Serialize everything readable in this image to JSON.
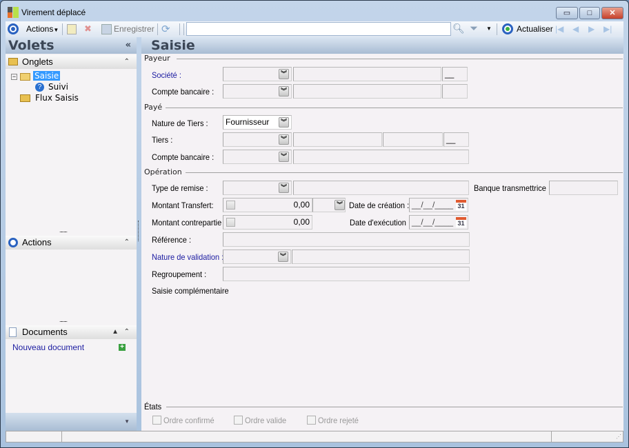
{
  "window": {
    "title": "Virement déplacé",
    "minimize": "▭",
    "maximize": "□",
    "close": "✕"
  },
  "toolbar": {
    "actions": "Actions",
    "save": "Enregistrer",
    "search_value": "",
    "refresh": "Actualiser"
  },
  "left": {
    "title": "Volets",
    "collapse": "«",
    "onglets": {
      "label": "Onglets",
      "tree": [
        {
          "label": "Saisie",
          "selected": true
        },
        {
          "label": "Suivi"
        },
        {
          "label": "Flux Saisis"
        }
      ]
    },
    "actions": {
      "label": "Actions"
    },
    "documents": {
      "label": "Documents",
      "new_doc": "Nouveau document"
    }
  },
  "main": {
    "title": "Saisie",
    "payeur": {
      "legend": "Payeur",
      "societe": "Société :",
      "compte": "Compte bancaire :",
      "societe_code": "__"
    },
    "paye": {
      "legend": "Payé",
      "nature": "Nature de Tiers :",
      "nature_value": "Fournisseur",
      "tiers": "Tiers :",
      "tiers_code": "__",
      "compte": "Compte bancaire :"
    },
    "operation": {
      "legend": "Opération",
      "type_remise": "Type de remise :",
      "banque": "Banque transmettrice :",
      "montant_transfert": "Montant Transfert:",
      "montant_transfert_value": "0,00",
      "date_creation": "Date de création :",
      "date_creation_value": "__/__/____",
      "montant_contrepartie": "Montant contrepartie",
      "montant_contrepartie_value": "0,00",
      "date_execution": "Date d'exécution :",
      "date_execution_value": "__/__/____",
      "reference": "Référence :",
      "nature_validation": "Nature de validation :",
      "regroupement": "Regroupement :",
      "saisie_comp": "Saisie complémentaire",
      "calendar": "31"
    },
    "etats": {
      "legend": "États",
      "items": [
        "Ordre confirmé",
        "Ordre valide",
        "Ordre rejeté"
      ]
    }
  }
}
